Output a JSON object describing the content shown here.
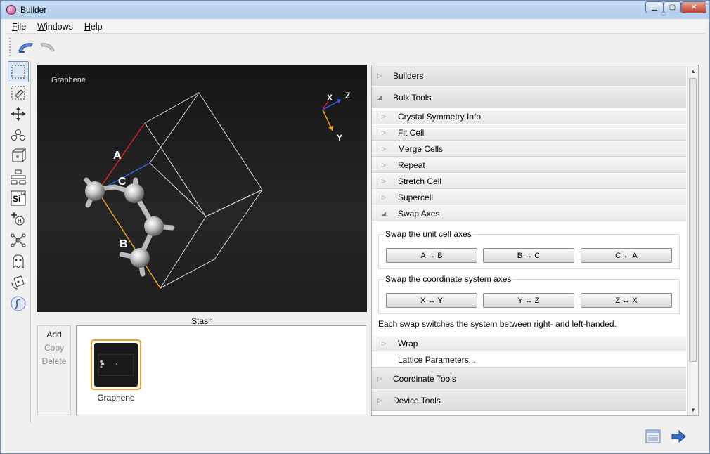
{
  "window": {
    "title": "Builder"
  },
  "menu": {
    "file": {
      "accel": "F",
      "rest": "ile"
    },
    "windows": {
      "accel": "W",
      "rest": "indows"
    },
    "help": {
      "accel": "H",
      "rest": "elp"
    }
  },
  "viewer": {
    "label": "Graphene",
    "axis_x": "X",
    "axis_y": "Y",
    "axis_z": "Z",
    "vec_a": "A",
    "vec_b": "B",
    "vec_c": "C"
  },
  "stash": {
    "title": "Stash",
    "add": "Add",
    "copy": "Copy",
    "delete": "Delete",
    "item_name": "Graphene"
  },
  "panel": {
    "builders": "Builders",
    "bulk_tools": "Bulk Tools",
    "sub_items": {
      "crystal_symmetry": "Crystal Symmetry Info",
      "fit_cell": "Fit Cell",
      "merge_cells": "Merge Cells",
      "repeat": "Repeat",
      "stretch_cell": "Stretch Cell",
      "supercell": "Supercell",
      "swap_axes": "Swap Axes",
      "wrap": "Wrap",
      "lattice_parameters": "Lattice Parameters..."
    },
    "swap_unit_title": "Swap the unit cell axes",
    "swap_unit_buttons": [
      "A ↔ B",
      "B ↔ C",
      "C ↔ A"
    ],
    "swap_coord_title": "Swap the coordinate system axes",
    "swap_coord_buttons": [
      "X ↔ Y",
      "Y ↔ Z",
      "Z ↔ X"
    ],
    "swap_note": "Each swap switches the system between right- and left-handed.",
    "coordinate_tools": "Coordinate Tools",
    "device_tools": "Device Tools"
  },
  "colors": {
    "vec_a": "#d02020",
    "vec_b": "#f0a020",
    "vec_c": "#3060e0",
    "stash_highlight": "#f0a020"
  },
  "icons": {
    "undo": "undo-icon",
    "redo": "redo-icon",
    "next": "arrow-right-icon",
    "panel": "panel-icon"
  }
}
